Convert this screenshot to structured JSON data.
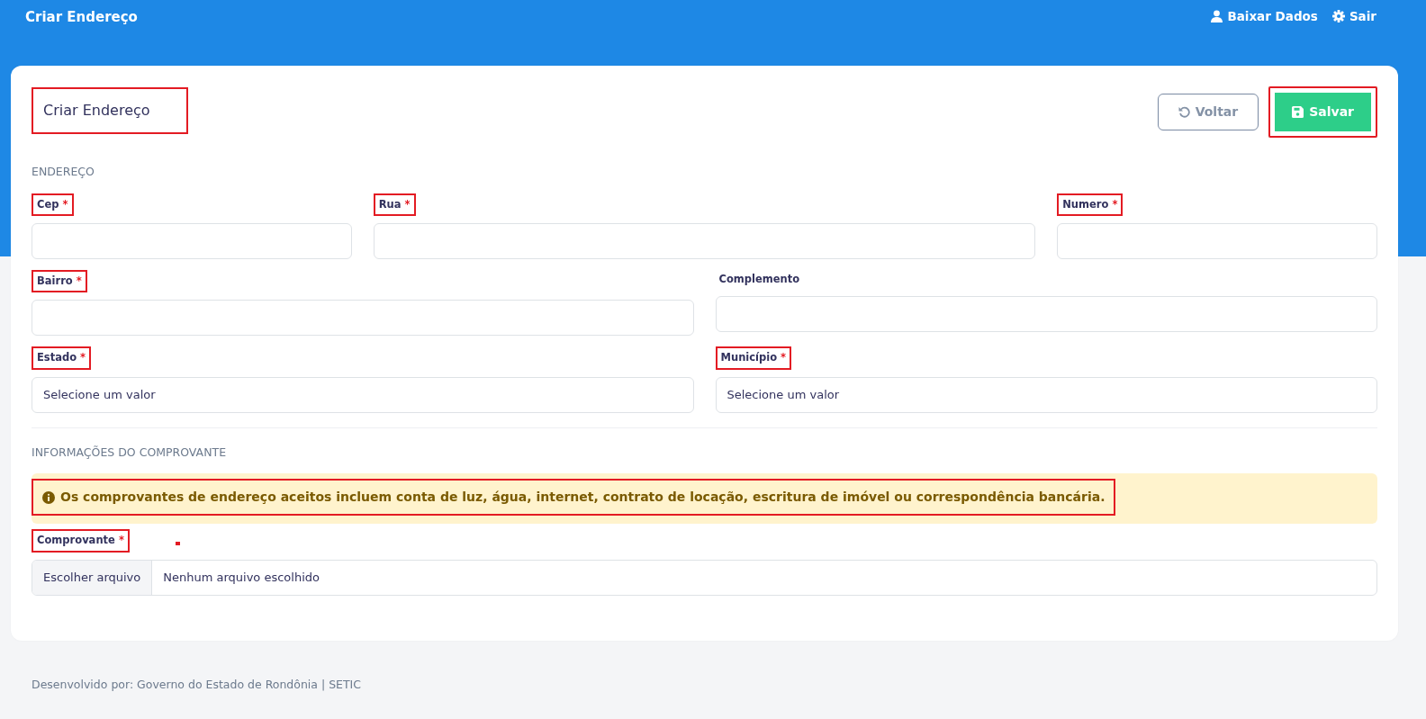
{
  "topbar": {
    "title": "Criar Endereço",
    "links": [
      {
        "kind": "user",
        "label": "Baixar Dados"
      },
      {
        "kind": "gear",
        "label": "Sair"
      }
    ]
  },
  "card": {
    "title": "Criar Endereço",
    "title_highlighted": true,
    "buttons": [
      {
        "kind": "back",
        "label": "Voltar",
        "highlighted": false
      },
      {
        "kind": "save",
        "label": "Salvar",
        "highlighted": true
      }
    ]
  },
  "sections": [
    {
      "heading": "ENDEREÇO",
      "rows": [
        [
          {
            "kind": "text",
            "label": "Cep",
            "required_mark": "*",
            "highlighted": true
          },
          {
            "kind": "text",
            "label": "Rua",
            "required_mark": "*",
            "highlighted": true
          },
          {
            "kind": "text",
            "label": "Numero",
            "required_mark": "*",
            "highlighted": true
          }
        ],
        [
          {
            "kind": "text",
            "label": "Bairro",
            "required_mark": "*",
            "highlighted": true
          },
          {
            "kind": "text",
            "label": "Complemento",
            "highlighted": false
          }
        ],
        [
          {
            "kind": "select",
            "label": "Estado",
            "required_mark": "*",
            "highlighted": true,
            "value": "Selecione um valor"
          },
          {
            "kind": "select",
            "label": "Município",
            "required_mark": "*",
            "highlighted": true,
            "value": "Selecione um valor"
          }
        ]
      ]
    },
    {
      "heading": "INFORMAÇÕES DO COMPROVANTE",
      "alert": {
        "text": "Os comprovantes de endereço aceitos incluem conta de luz, água, internet, contrato de locação, escritura de imóvel ou correspondência bancária.",
        "highlighted": true
      },
      "rows": [
        [
          {
            "kind": "file",
            "label": "Comprovante",
            "required_mark": "*",
            "highlighted": true,
            "annotation_dot": true,
            "button": "Escolher arquivo",
            "value": "Nenhum arquivo escolhido"
          }
        ]
      ]
    }
  ],
  "footer": "Desenvolvido por: Governo do Estado de Rondônia | SETIC"
}
